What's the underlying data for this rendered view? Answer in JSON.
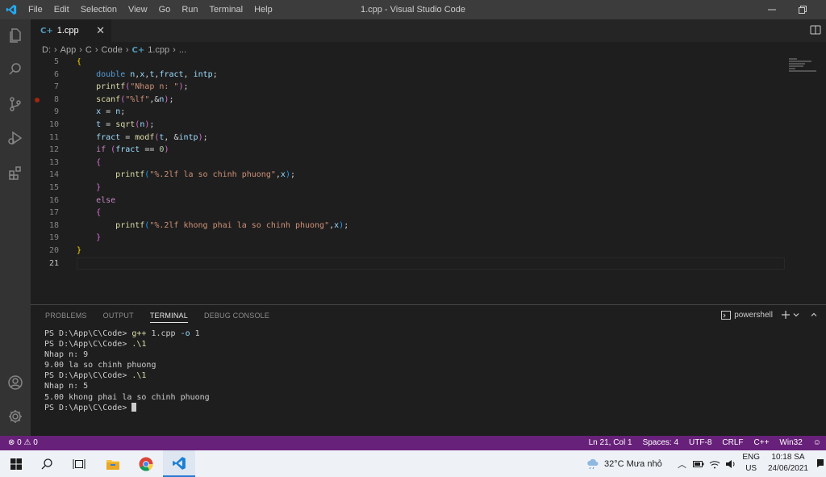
{
  "titlebar": {
    "menu": [
      "File",
      "Edit",
      "Selection",
      "View",
      "Go",
      "Run",
      "Terminal",
      "Help"
    ],
    "title": "1.cpp - Visual Studio Code"
  },
  "tab": {
    "icon_glyph": "C+",
    "name": "1.cpp",
    "close": "✕"
  },
  "breadcrumb": {
    "parts": [
      "D:",
      "App",
      "C",
      "Code"
    ],
    "file_icon": "C+",
    "file": "1.cpp",
    "more": "..."
  },
  "editor": {
    "lines": [
      {
        "n": "5",
        "tokens": [
          {
            "t": "{",
            "c": "b1"
          }
        ]
      },
      {
        "n": "6",
        "tokens": [
          {
            "t": "    "
          },
          {
            "t": "double",
            "c": "kw"
          },
          {
            "t": " "
          },
          {
            "t": "n",
            "c": "var"
          },
          {
            "t": ",",
            "c": "op"
          },
          {
            "t": "x",
            "c": "var"
          },
          {
            "t": ",",
            "c": "op"
          },
          {
            "t": "t",
            "c": "var"
          },
          {
            "t": ",",
            "c": "op"
          },
          {
            "t": "fract",
            "c": "var"
          },
          {
            "t": ", ",
            "c": "op"
          },
          {
            "t": "intp",
            "c": "var"
          },
          {
            "t": ";",
            "c": "op"
          }
        ]
      },
      {
        "n": "7",
        "tokens": [
          {
            "t": "    "
          },
          {
            "t": "printf",
            "c": "fn"
          },
          {
            "t": "(",
            "c": "b2"
          },
          {
            "t": "\"Nhap n: \"",
            "c": "str"
          },
          {
            "t": ")",
            "c": "b2"
          },
          {
            "t": ";",
            "c": "op"
          }
        ]
      },
      {
        "n": "8",
        "bp": true,
        "tokens": [
          {
            "t": "    "
          },
          {
            "t": "scanf",
            "c": "fn"
          },
          {
            "t": "(",
            "c": "b2"
          },
          {
            "t": "\"%lf\"",
            "c": "str"
          },
          {
            "t": ",&",
            "c": "op"
          },
          {
            "t": "n",
            "c": "var"
          },
          {
            "t": ")",
            "c": "b2"
          },
          {
            "t": ";",
            "c": "op"
          }
        ]
      },
      {
        "n": "9",
        "tokens": [
          {
            "t": "    "
          },
          {
            "t": "x",
            "c": "var"
          },
          {
            "t": " = ",
            "c": "op"
          },
          {
            "t": "n",
            "c": "var"
          },
          {
            "t": ";",
            "c": "op"
          }
        ]
      },
      {
        "n": "10",
        "tokens": [
          {
            "t": "    "
          },
          {
            "t": "t",
            "c": "var"
          },
          {
            "t": " = ",
            "c": "op"
          },
          {
            "t": "sqrt",
            "c": "fn"
          },
          {
            "t": "(",
            "c": "b2"
          },
          {
            "t": "n",
            "c": "var"
          },
          {
            "t": ")",
            "c": "b2"
          },
          {
            "t": ";",
            "c": "op"
          }
        ]
      },
      {
        "n": "11",
        "tokens": [
          {
            "t": "    "
          },
          {
            "t": "fract",
            "c": "var"
          },
          {
            "t": " = ",
            "c": "op"
          },
          {
            "t": "modf",
            "c": "fn"
          },
          {
            "t": "(",
            "c": "b2"
          },
          {
            "t": "t",
            "c": "var"
          },
          {
            "t": ", &",
            "c": "op"
          },
          {
            "t": "intp",
            "c": "var"
          },
          {
            "t": ")",
            "c": "b2"
          },
          {
            "t": ";",
            "c": "op"
          }
        ]
      },
      {
        "n": "12",
        "tokens": [
          {
            "t": "    "
          },
          {
            "t": "if",
            "c": "ctl"
          },
          {
            "t": " "
          },
          {
            "t": "(",
            "c": "b2"
          },
          {
            "t": "fract",
            "c": "var"
          },
          {
            "t": " == ",
            "c": "op"
          },
          {
            "t": "0",
            "c": "num"
          },
          {
            "t": ")",
            "c": "b2"
          }
        ]
      },
      {
        "n": "13",
        "tokens": [
          {
            "t": "    "
          },
          {
            "t": "{",
            "c": "b2"
          }
        ]
      },
      {
        "n": "14",
        "tokens": [
          {
            "t": "        "
          },
          {
            "t": "printf",
            "c": "fn"
          },
          {
            "t": "(",
            "c": "b3"
          },
          {
            "t": "\"%.2lf la so chinh phuong\"",
            "c": "str"
          },
          {
            "t": ",",
            "c": "op"
          },
          {
            "t": "x",
            "c": "var"
          },
          {
            "t": ")",
            "c": "b3"
          },
          {
            "t": ";",
            "c": "op"
          }
        ]
      },
      {
        "n": "15",
        "tokens": [
          {
            "t": "    "
          },
          {
            "t": "}",
            "c": "b2"
          }
        ]
      },
      {
        "n": "16",
        "tokens": [
          {
            "t": "    "
          },
          {
            "t": "else",
            "c": "ctl"
          }
        ]
      },
      {
        "n": "17",
        "tokens": [
          {
            "t": "    "
          },
          {
            "t": "{",
            "c": "b2"
          }
        ]
      },
      {
        "n": "18",
        "tokens": [
          {
            "t": "        "
          },
          {
            "t": "printf",
            "c": "fn"
          },
          {
            "t": "(",
            "c": "b3"
          },
          {
            "t": "\"%.2lf khong phai la so chinh phuong\"",
            "c": "str"
          },
          {
            "t": ",",
            "c": "op"
          },
          {
            "t": "x",
            "c": "var"
          },
          {
            "t": ")",
            "c": "b3"
          },
          {
            "t": ";",
            "c": "op"
          }
        ]
      },
      {
        "n": "19",
        "tokens": [
          {
            "t": "    "
          },
          {
            "t": "}",
            "c": "b2"
          }
        ]
      },
      {
        "n": "20",
        "tokens": [
          {
            "t": "}",
            "c": "b1"
          }
        ]
      },
      {
        "n": "21",
        "current": true,
        "tokens": []
      }
    ]
  },
  "panel": {
    "tabs": [
      "PROBLEMS",
      "OUTPUT",
      "TERMINAL",
      "DEBUG CONSOLE"
    ],
    "active_tab": "TERMINAL",
    "shell": "powershell",
    "terminal": [
      [
        {
          "t": "PS D:\\App\\C\\Code> "
        },
        {
          "t": "g++",
          "c": "cmd"
        },
        {
          "t": " 1.cpp "
        },
        {
          "t": "-o",
          "c": "arg"
        },
        {
          "t": " 1"
        }
      ],
      [
        {
          "t": "PS D:\\App\\C\\Code> "
        },
        {
          "t": ".\\1",
          "c": "cmd"
        }
      ],
      [
        {
          "t": "Nhap n: 9"
        }
      ],
      [
        {
          "t": "9.00 la so chinh phuong"
        }
      ],
      [
        {
          "t": "PS D:\\App\\C\\Code> "
        },
        {
          "t": ".\\1",
          "c": "cmd"
        }
      ],
      [
        {
          "t": "Nhap n: 5"
        }
      ],
      [
        {
          "t": "5.00 khong phai la so chinh phuong"
        }
      ],
      [
        {
          "t": "PS D:\\App\\C\\Code> "
        },
        {
          "cursor": true
        }
      ]
    ]
  },
  "statusbar": {
    "errors": "0",
    "warnings": "0",
    "position": "Ln 21, Col 1",
    "spaces": "Spaces: 4",
    "encoding": "UTF-8",
    "eol": "CRLF",
    "language": "C++",
    "config": "Win32"
  },
  "taskbar": {
    "weather": "32°C  Mưa nhỏ",
    "lang_top": "ENG",
    "lang_bottom": "US",
    "time": "10:18 SA",
    "date": "24/06/2021"
  },
  "colors": {
    "statusbar": "#68217a",
    "activitybar": "#333333",
    "editor_bg": "#1e1e1e",
    "titlebar": "#3c3c3c"
  }
}
